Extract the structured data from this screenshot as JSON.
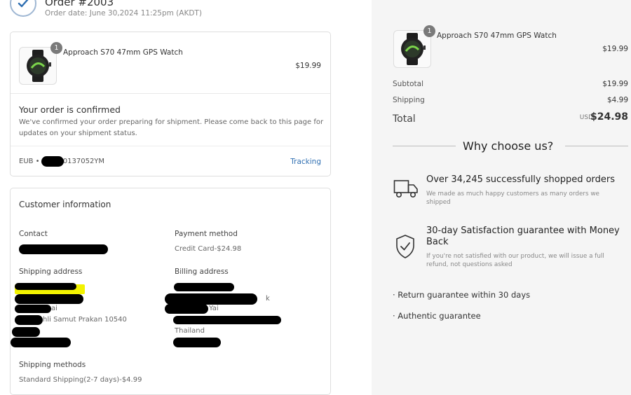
{
  "order": {
    "title": "Order #2003",
    "date": "Order date: June 30,2024 11:25pm (AKDT)"
  },
  "item": {
    "name": "Approach S70 47mm GPS Watch",
    "qty": "1",
    "price": "$19.99"
  },
  "confirmation": {
    "title": "Your order is confirmed",
    "text": "We've confirmed your order preparing for shipment. Please come back to this page for updates on your shipment status.",
    "tracking_prefix": "EUB •",
    "tracking_suffix": "0137052YM",
    "tracking_link": "Tracking"
  },
  "customer": {
    "title": "Customer information",
    "contact_label": "Contact",
    "payment_label": "Payment method",
    "payment_value": "Credit Card-$24.98",
    "shipping_address_label": "Shipping address",
    "shipping_address_visible_1": "ai",
    "shipping_address_visible_2": "hli Samut Prakan 10540",
    "billing_address_label": "Billing address",
    "billing_visible_1": "k",
    "billing_visible_2": "Yai",
    "billing_visible_3": "Thailand",
    "shipping_methods_label": "Shipping methods",
    "shipping_methods_value": "Standard Shipping(2-7 days)-$4.99"
  },
  "summary": {
    "item_name": "Approach S70 47mm GPS Watch",
    "item_qty": "1",
    "item_price": "$19.99",
    "subtotal_label": "Subtotal",
    "subtotal_value": "$19.99",
    "shipping_label": "Shipping",
    "shipping_value": "$4.99",
    "total_label": "Total",
    "total_currency": "USD",
    "total_value": "$24.98"
  },
  "why": {
    "title": "Why choose us?",
    "feature1_title": "Over 34,245 successfully shopped orders",
    "feature1_sub": "We made as much happy customers as many orders we shipped",
    "feature2_title": "30-day Satisfaction guarantee with Money Back",
    "feature2_sub": "If you're not satisfied with our product, we will issue a full refund, not questions asked",
    "bullet1": "· Return guarantee within 30 days",
    "bullet2": "· Authentic guarantee"
  },
  "icons": {
    "check": "check-icon",
    "watch": "watch-icon",
    "truck": "truck-icon",
    "shield": "shield-check-icon"
  },
  "colors": {
    "accent_link": "#2f6fb2",
    "panel_bg": "#f5f5f5",
    "highlight": "#f2f200"
  }
}
